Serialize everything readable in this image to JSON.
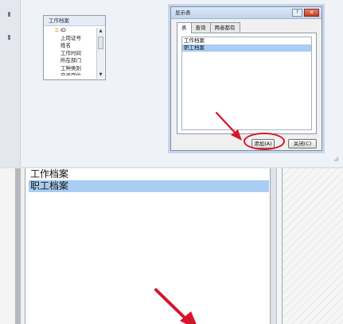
{
  "colors": {
    "selection": "#a9cdf3",
    "annotation_red": "#d8142a",
    "dialog_border": "#7f8da3",
    "background": "#eff3f8"
  },
  "field_list": {
    "title": "工作档案",
    "fields": [
      {
        "label": "ID",
        "primary_key": true
      },
      {
        "label": "上岗证号"
      },
      {
        "label": "姓名"
      },
      {
        "label": "工作时间"
      },
      {
        "label": "所在部门"
      },
      {
        "label": "工种类别"
      },
      {
        "label": "自子岗位"
      }
    ],
    "key_icon": "key-icon",
    "scroll_up_icon": "arrow-up-icon",
    "scroll_down_icon": "arrow-down-icon"
  },
  "dialog": {
    "title": "显示表",
    "help_label": "?",
    "close_label": "✕",
    "tabs": [
      {
        "label": "表",
        "active": true
      },
      {
        "label": "查询",
        "active": false
      },
      {
        "label": "两者都有",
        "active": false
      }
    ],
    "tables": [
      {
        "label": "工作档案",
        "selected": false
      },
      {
        "label": "职工档案",
        "selected": true
      }
    ],
    "add_button_label": "添加(A)",
    "close_button_label": "关闭(C)"
  },
  "zoom": {
    "items": [
      {
        "label": "工作档案",
        "selected": false
      },
      {
        "label": "职工档案",
        "selected": true
      }
    ]
  }
}
